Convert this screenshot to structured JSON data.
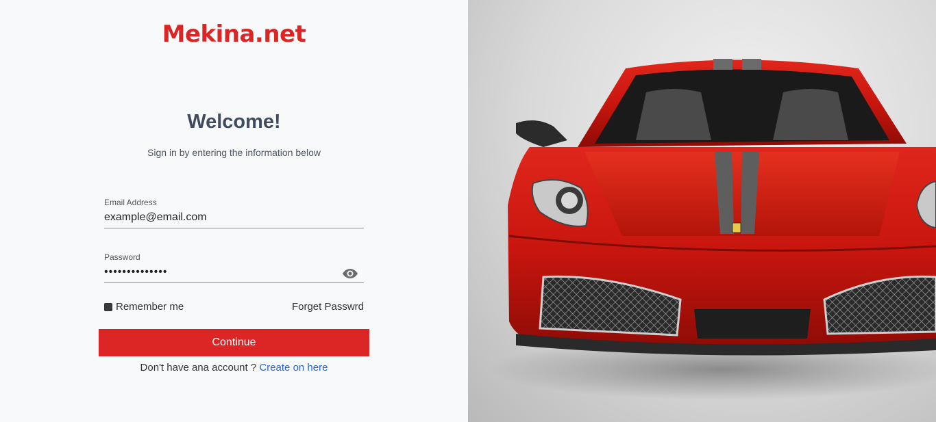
{
  "brand": {
    "name": "Mekina.net",
    "color": "#dc2626"
  },
  "heading": {
    "title": "Welcome!",
    "subtitle": "Sign in by entering the information below"
  },
  "form": {
    "email": {
      "label": "Email Address",
      "value": "example@email.com"
    },
    "password": {
      "label": "Password",
      "value": "••••••••••••••",
      "toggle_icon": "eye-icon"
    },
    "remember_label": "Remember me",
    "remember_checked": true,
    "forget_label": "Forget Passwrd",
    "submit_label": "Continue"
  },
  "signup": {
    "prompt": "Don't have ana account ?",
    "link_label": "Create on here",
    "link_color": "#2563eb"
  },
  "hero": {
    "subject": "red sports car front view"
  }
}
